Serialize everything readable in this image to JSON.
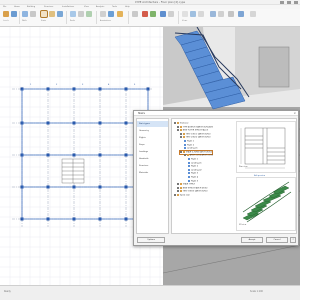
{
  "window": {
    "title": "CYPE Architecture - Floor plan [4].cype"
  },
  "ribbon": {
    "tabs": [
      "File",
      "Home",
      "Building",
      "Structure",
      "Installations",
      "View",
      "Analysis",
      "Tools",
      "Help"
    ],
    "groups": [
      "Levels",
      "Walls",
      "Openings",
      "Stairs",
      "Floors",
      "Roofs",
      "Annotations",
      "Views"
    ]
  },
  "dialog": {
    "title": "Stairs",
    "close": "×",
    "nav": [
      "Stair types",
      "Geometry",
      "Flights",
      "Steps",
      "Landings",
      "Handrails",
      "Structure",
      "Materials"
    ],
    "tree": [
      "Staircase",
      "TYPE ASTRUCT/ARCH 05/50/AT5",
      "NEW FLOOR STRUCT/ALL/3",
      "TEST 1/S1/1 (ARCH 05/50)",
      "TEST 2/S2/2 (ARCH 05/50)",
      "Flight 1",
      "Flight 2",
      "Landing 01",
      "STAIR U-TURN (ARCH 05/50)",
      "ARCH 01/50 ARCH 05/50",
      "Flight 1",
      "Landing 01",
      "Flight 2",
      "Landing 02",
      "Flight 3",
      "Flight 4",
      "Flight 5",
      "STAIR TYPE-Y",
      "NEW STRUCT/ARCH 05/50",
      "TEST 3/S3/3 (ARCH 05/50)",
      "Spiral stair"
    ],
    "preview_top_caption": "Plan view",
    "preview_3d_caption": "3D view",
    "preview_link": "Edit preview",
    "buttons": {
      "accept": "Accept",
      "cancel": "Cancel",
      "help": "?"
    },
    "footer_link": "Options"
  },
  "status": {
    "left": "Ready",
    "right": "Scale 1:100"
  },
  "colors": {
    "stairs_blue": "#5b8fd6",
    "preview_green": "#3c8a4a",
    "selection_orange": "#c87a2a"
  }
}
